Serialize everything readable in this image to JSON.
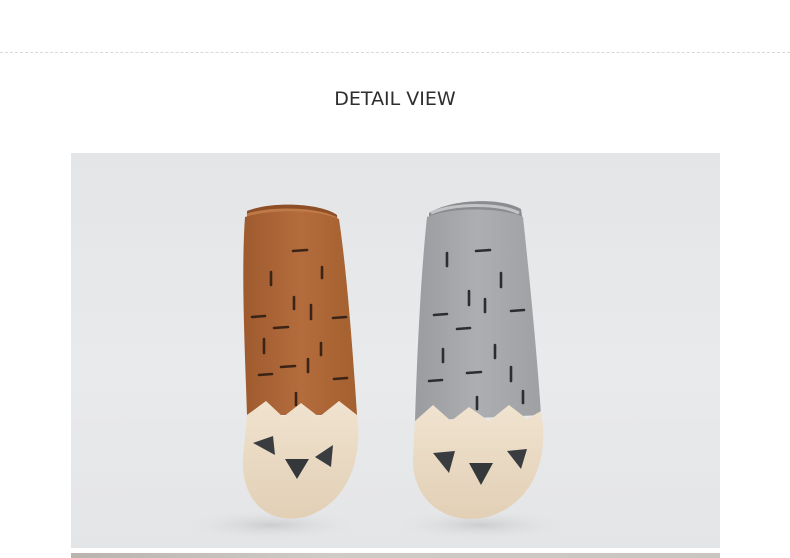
{
  "section": {
    "title": "DETAIL VIEW"
  },
  "colors": {
    "background": "#ffffff",
    "title": "#2e2e2e",
    "photo_backdrop": "#e6e7e9",
    "orange_sock": "#b06a3c",
    "gray_sock": "#a3a5a8",
    "toe_cream": "#ecdcc6",
    "claw": "#3a3d40"
  }
}
